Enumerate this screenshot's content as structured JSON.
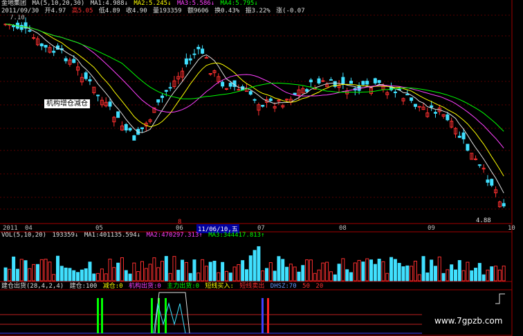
{
  "header": {
    "stock_name": "金地集团",
    "ma_label": "MA(5,10,20,30)",
    "ma1": "MA1:4.988↓",
    "ma2": "MA2:5.245↓",
    "ma3": "MA3:5.586↓",
    "ma4": "MA4:5.795↓",
    "date": "2011/09/30",
    "open": "开4.97",
    "high": "高5.05",
    "low": "低4.89",
    "close": "收4.90",
    "volume": "量193359",
    "amount": "额9606",
    "turnover": "换0.43%",
    "amplitude": "振3.22%",
    "change": "涨(-0.07"
  },
  "price_chart": {
    "top_price_label": "7.10",
    "low_price_label": "4.88",
    "annotation": "机构增仓减仓",
    "months": [
      "2011",
      "04",
      "05",
      "06",
      "07",
      "08",
      "09",
      "10"
    ],
    "cursor_date": "11/06/10,五",
    "marker": "8"
  },
  "volume_pane": {
    "label": "VOL(5,10,20)",
    "value": "193359↓",
    "ma1": "MA1:401135.594↓",
    "ma2": "MA2:470297.313↑",
    "ma3": "MA3:344417.813↑"
  },
  "indicator_pane": {
    "name": "建仓出货(28,4,2,4)",
    "jiancang": "建仓:100",
    "jiancang_out": "减仓:0",
    "jigou": "机构出货:0",
    "zhuli": "主力出货:0",
    "buy": "短线买入:",
    "sell": "短线卖出",
    "dhsz": "DHSZ:70",
    "v50": "50",
    "v20": "20"
  },
  "watermark": "www.7gpzb.com",
  "colors": {
    "up": "#ff3030",
    "down": "#40e0ff",
    "ma5": "#e0e0e0",
    "ma10": "#ffff00",
    "ma20": "#ff40ff",
    "ma30": "#00ff00",
    "grid": "#a00000"
  }
}
